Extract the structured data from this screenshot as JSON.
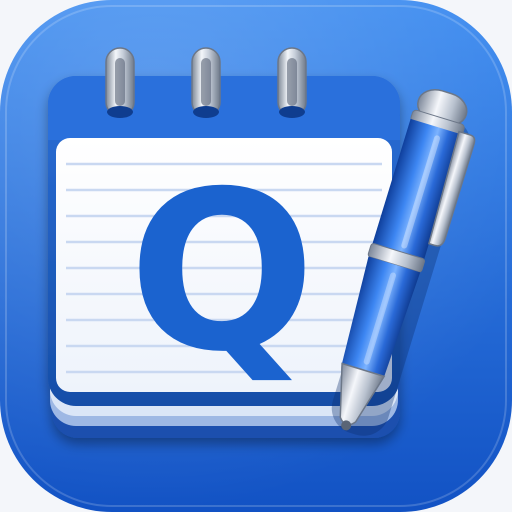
{
  "app_icon": {
    "name": "notepad-with-pen",
    "letter": "Q",
    "icons": [
      "spiral-notepad-icon",
      "ballpoint-pen-icon"
    ],
    "colors": {
      "background_top": "#3f8df0",
      "background_bottom": "#1252c4",
      "notepad_cover": "#1d5fc9",
      "notepad_cover_dark": "#164ea8",
      "paper": "#fdfeff",
      "paper_lines": "#c9d8f1",
      "letter": "#1b63cf",
      "pen_body": "#1f5fd0",
      "pen_highlight": "#6aa5ff",
      "metal": "#d4dbe6",
      "metal_dark": "#8c97a8"
    }
  }
}
